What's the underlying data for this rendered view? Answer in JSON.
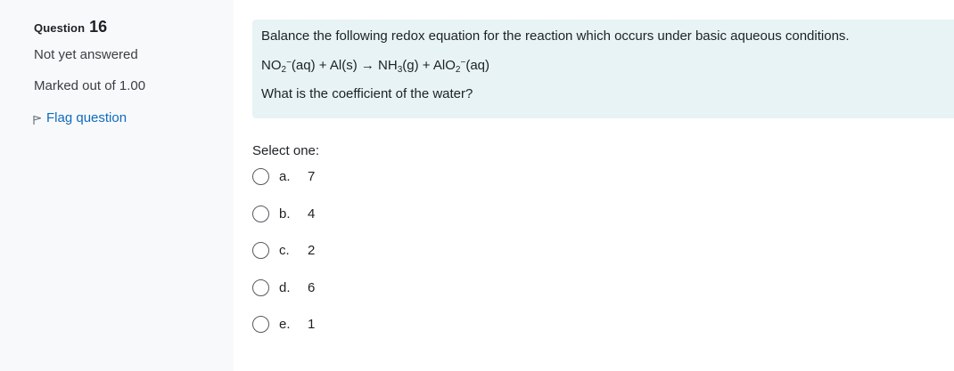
{
  "info": {
    "question_label": "Question",
    "question_number": "16",
    "state": "Not yet answered",
    "grade": "Marked out of 1.00",
    "flag_label": "Flag question"
  },
  "question": {
    "text": "Balance the following redox equation for the reaction which occurs under basic aqueous conditions.",
    "equation": {
      "reactant1": "NO",
      "reactant1_sub": "2",
      "reactant1_sup": "−",
      "reactant1_state": "(aq)",
      "plus1": " + ",
      "reactant2": "Al(s)",
      "arrow": " → ",
      "product1": "NH",
      "product1_sub": "3",
      "product1_state": "(g)",
      "plus2": " + ",
      "product2": "AlO",
      "product2_sub": "2",
      "product2_sup": "−",
      "product2_state": "(aq)"
    },
    "ask": "What is the coefficient of the water?"
  },
  "answer_prompt": "Select one:",
  "options": [
    {
      "letter": "a.",
      "value": "7"
    },
    {
      "letter": "b.",
      "value": "4"
    },
    {
      "letter": "c.",
      "value": "2"
    },
    {
      "letter": "d.",
      "value": "6"
    },
    {
      "letter": "e.",
      "value": "1"
    }
  ],
  "colors": {
    "info_bg": "#f8f9fa",
    "question_bg": "#e7f3f5",
    "link": "#0f6cbf"
  }
}
